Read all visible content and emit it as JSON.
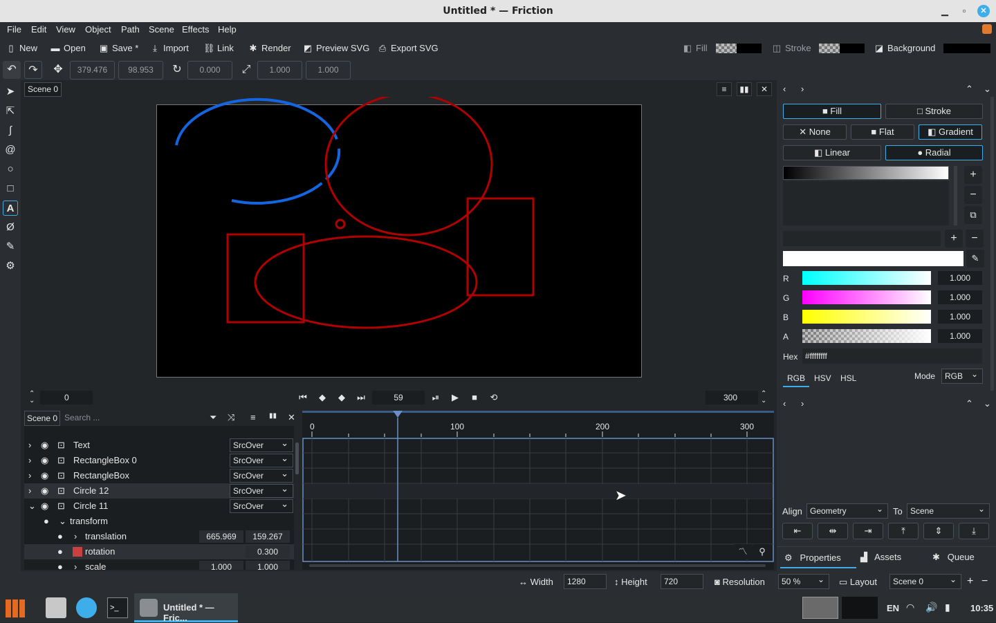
{
  "window": {
    "title": "Untitled * — Friction"
  },
  "menu": [
    "File",
    "Edit",
    "View",
    "Object",
    "Path",
    "Scene",
    "Effects",
    "Help"
  ],
  "toolbar": {
    "new": "New",
    "open": "Open",
    "save": "Save *",
    "import": "Import",
    "link": "Link",
    "render": "Render",
    "preview_svg": "Preview SVG",
    "export_svg": "Export SVG",
    "fill": "Fill",
    "stroke": "Stroke",
    "background": "Background"
  },
  "transform_bar": {
    "x": "379.476",
    "y": "98.953",
    "rotation": "0.000",
    "scale_x": "1.000",
    "scale_y": "1.000"
  },
  "canvas": {
    "scene_tab": "Scene 0"
  },
  "frame_bar": {
    "start": "0",
    "current": "59",
    "end": "300"
  },
  "timeline": {
    "ticks": [
      "0",
      "100",
      "200",
      "300"
    ]
  },
  "layers": {
    "scene_label": "Scene 0",
    "search_placeholder": "Search ...",
    "rows": [
      {
        "name": "Text",
        "blend": "SrcOver"
      },
      {
        "name": "RectangleBox 0",
        "blend": "SrcOver"
      },
      {
        "name": "RectangleBox",
        "blend": "SrcOver"
      },
      {
        "name": "Circle 12",
        "blend": "SrcOver"
      },
      {
        "name": "Circle 11",
        "blend": "SrcOver"
      }
    ],
    "transform": "transform",
    "translation": {
      "label": "translation",
      "x": "665.969",
      "y": "159.267"
    },
    "rotation": {
      "label": "rotation",
      "value": "0.300"
    },
    "scale": {
      "label": "scale",
      "x": "1.000",
      "y": "1.000"
    }
  },
  "fill_panel": {
    "fill_tab": "Fill",
    "stroke_tab": "Stroke",
    "none": "None",
    "flat": "Flat",
    "gradient": "Gradient",
    "linear": "Linear",
    "radial": "Radial",
    "channels": [
      {
        "label": "R",
        "value": "1.000"
      },
      {
        "label": "G",
        "value": "1.000"
      },
      {
        "label": "B",
        "value": "1.000"
      },
      {
        "label": "A",
        "value": "1.000"
      }
    ],
    "hex_label": "Hex",
    "hex_value": "#ffffffff",
    "modes": [
      "RGB",
      "HSV",
      "HSL"
    ],
    "mode_label": "Mode",
    "mode_value": "RGB"
  },
  "align": {
    "label": "Align",
    "value": "Geometry",
    "to_label": "To",
    "to_value": "Scene"
  },
  "right_tabs": {
    "properties": "Properties",
    "assets": "Assets",
    "queue": "Queue"
  },
  "bottom_bar": {
    "width_label": "Width",
    "width": "1280",
    "height_label": "Height",
    "height": "720",
    "resolution_label": "Resolution",
    "resolution": "50 %",
    "layout_label": "Layout",
    "layout": "Scene 0"
  },
  "taskbar": {
    "app": "Untitled * — Fric...",
    "lang": "EN",
    "time": "10:35"
  },
  "colors": {
    "accent": "#3daee9",
    "shape_red": "#b00000",
    "shape_blue": "#1565e0"
  }
}
